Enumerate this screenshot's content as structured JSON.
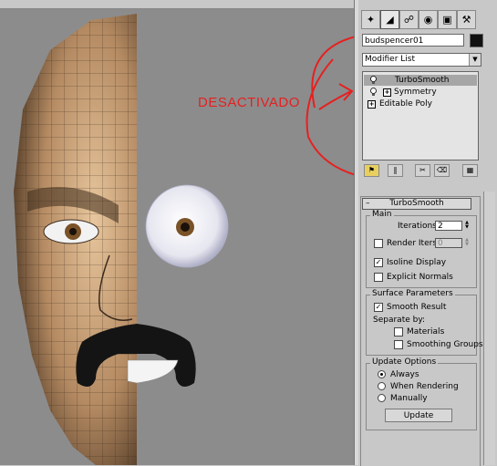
{
  "viewport": {
    "annotation_text": "DESACTIVADO"
  },
  "command_panel": {
    "tabs": [
      "create-icon",
      "modify-icon",
      "hierarchy-icon",
      "motion-icon",
      "display-icon",
      "utilities-icon"
    ],
    "object_name": "budspencer01",
    "object_color": "#111111",
    "modifier_list_label": "Modifier List",
    "stack": [
      {
        "label": "TurboSmooth",
        "selected": true,
        "bulb": true,
        "expander": false
      },
      {
        "label": "Symmetry",
        "selected": false,
        "bulb": true,
        "expander": true
      },
      {
        "label": "Editable Poly",
        "selected": false,
        "bulb": false,
        "expander": true
      }
    ]
  },
  "rollout": {
    "title": "TurboSmooth",
    "main_group": "Main",
    "iterations_label": "Iterations:",
    "iterations_value": "2",
    "render_iters_label": "Render Iters:",
    "render_iters_value": "0",
    "isoline_label": "Isoline Display",
    "isoline_checked": true,
    "explicit_normals_label": "Explicit Normals",
    "explicit_normals_checked": false,
    "surface_group": "Surface Parameters",
    "smooth_result_label": "Smooth Result",
    "smooth_result_checked": true,
    "separate_by_label": "Separate by:",
    "materials_label": "Materials",
    "smoothing_groups_label": "Smoothing Groups",
    "update_group": "Update Options",
    "always_label": "Always",
    "when_rendering_label": "When Rendering",
    "manually_label": "Manually",
    "update_selected": "Always",
    "update_button": "Update"
  },
  "colors": {
    "annotation_red": "#e62020",
    "panel_bg": "#c8c8c8",
    "viewport_bg": "#8c8c8c",
    "selected_row": "#a6a6a6"
  }
}
